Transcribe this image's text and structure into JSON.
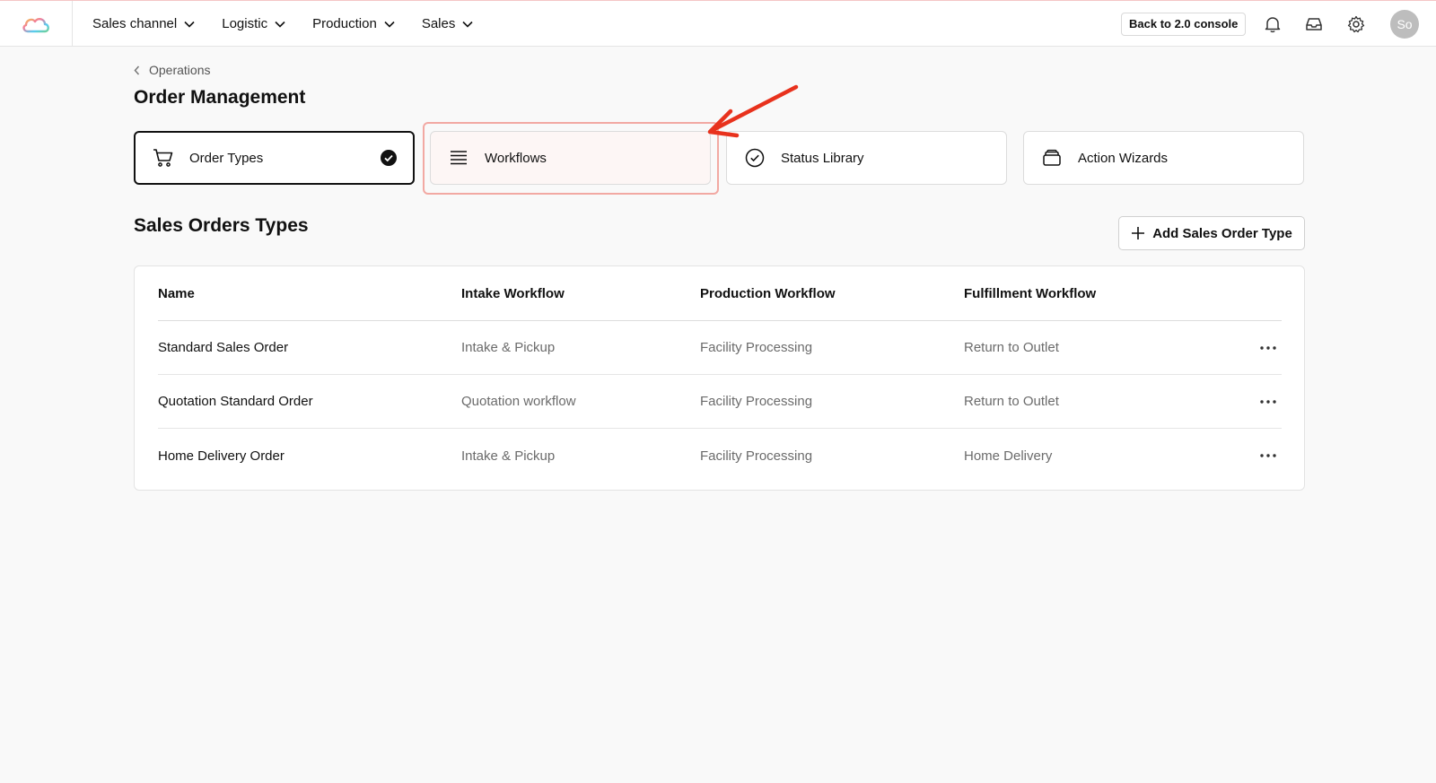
{
  "nav": {
    "items": [
      {
        "label": "Sales channel"
      },
      {
        "label": "Logistic"
      },
      {
        "label": "Production"
      },
      {
        "label": "Sales"
      }
    ],
    "console_label": "Back to 2.0 console",
    "avatar_initials": "So"
  },
  "breadcrumb": {
    "label": "Operations"
  },
  "page": {
    "title": "Order Management"
  },
  "cards": [
    {
      "label": "Order Types",
      "icon": "cart-icon",
      "selected": true
    },
    {
      "label": "Workflows",
      "icon": "list-icon",
      "selected": false
    },
    {
      "label": "Status Library",
      "icon": "check-circle-icon",
      "selected": false
    },
    {
      "label": "Action Wizards",
      "icon": "stack-icon",
      "selected": false
    }
  ],
  "section": {
    "title": "Sales Orders Types",
    "add_label": "Add Sales Order Type"
  },
  "table": {
    "columns": [
      "Name",
      "Intake Workflow",
      "Production Workflow",
      "Fulfillment Workflow"
    ],
    "rows": [
      [
        "Standard Sales Order",
        "Intake & Pickup",
        "Facility Processing",
        "Return to Outlet"
      ],
      [
        "Quotation Standard Order",
        "Quotation workflow",
        "Facility Processing",
        "Return to Outlet"
      ],
      [
        "Home Delivery Order",
        "Intake & Pickup",
        "Facility Processing",
        "Home Delivery"
      ]
    ]
  },
  "colors": {
    "annotation_arrow": "#e8321d",
    "highlight_border": "#f2a9a3",
    "selected_border": "#111111"
  }
}
